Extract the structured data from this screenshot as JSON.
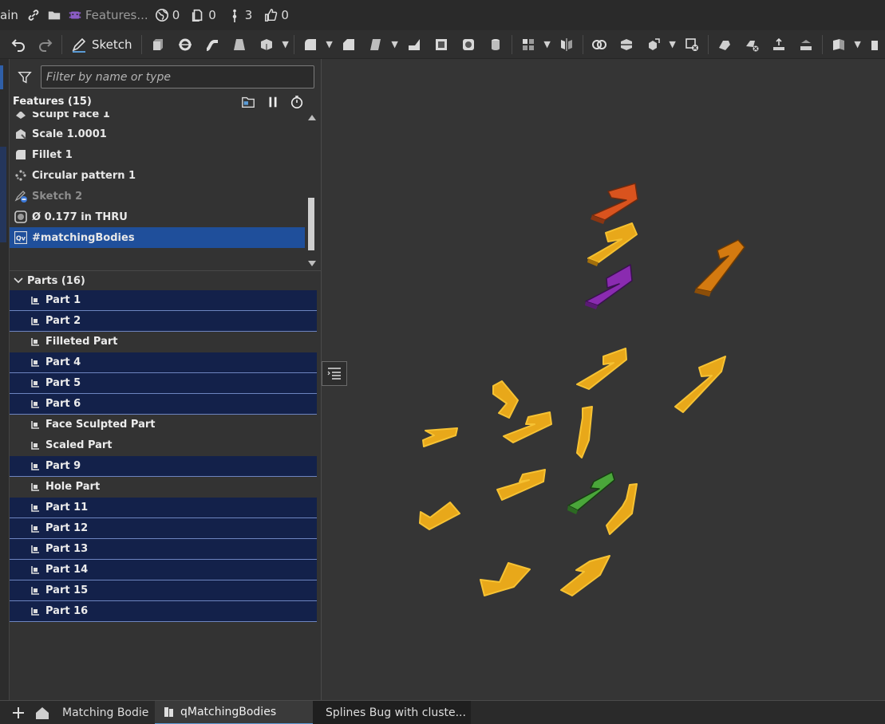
{
  "topbar": {
    "branch_fragment": "ain",
    "doc_title": "Features...",
    "versions_count": "0",
    "branches_count": "3",
    "likes_count": "0"
  },
  "toolbar": {
    "sketch_label": "Sketch"
  },
  "filter": {
    "placeholder": "Filter by name or type"
  },
  "features": {
    "title": "Features (15)",
    "items": [
      {
        "label": "Sculpt Face 1",
        "icon": "sculpt-face-icon",
        "state": "normal"
      },
      {
        "label": "Scale 1.0001",
        "icon": "scale-icon",
        "state": "normal"
      },
      {
        "label": "Fillet 1",
        "icon": "fillet-icon",
        "state": "normal"
      },
      {
        "label": "Circular pattern 1",
        "icon": "circular-pattern-icon",
        "state": "normal"
      },
      {
        "label": "Sketch 2",
        "icon": "sketch-icon",
        "state": "suppressed"
      },
      {
        "label": "Ø 0.177 in THRU",
        "icon": "hole-icon",
        "state": "normal"
      },
      {
        "label": "#matchingBodies",
        "icon": "query-variable-icon",
        "state": "selected"
      }
    ]
  },
  "parts": {
    "title": "Parts (16)",
    "items": [
      {
        "label": "Part 1",
        "selected": true
      },
      {
        "label": "Part 2",
        "selected": true
      },
      {
        "label": "Filleted Part",
        "selected": false
      },
      {
        "label": "Part 4",
        "selected": true
      },
      {
        "label": "Part 5",
        "selected": true
      },
      {
        "label": "Part 6",
        "selected": true
      },
      {
        "label": "Face Sculpted Part",
        "selected": false
      },
      {
        "label": "Scaled Part",
        "selected": false
      },
      {
        "label": "Part 9",
        "selected": true
      },
      {
        "label": "Hole Part",
        "selected": false
      },
      {
        "label": "Part 11",
        "selected": true
      },
      {
        "label": "Part 12",
        "selected": true
      },
      {
        "label": "Part 13",
        "selected": true
      },
      {
        "label": "Part 14",
        "selected": true
      },
      {
        "label": "Part 15",
        "selected": true
      },
      {
        "label": "Part 16",
        "selected": true
      }
    ]
  },
  "tabs": {
    "items": [
      {
        "label": "Matching Bodie",
        "active": false
      },
      {
        "label": "qMatchingBodies",
        "active": true
      },
      {
        "label": "Splines Bug with cluste...",
        "active": false
      }
    ]
  },
  "colors": {
    "accent": "#1f4f9b",
    "part_selected": "#13214a",
    "highlight_yellow": "#e8a81a",
    "orange_red": "#d9531e",
    "orange": "#d47a10",
    "purple": "#8a2bb0",
    "green": "#4aa63a"
  }
}
